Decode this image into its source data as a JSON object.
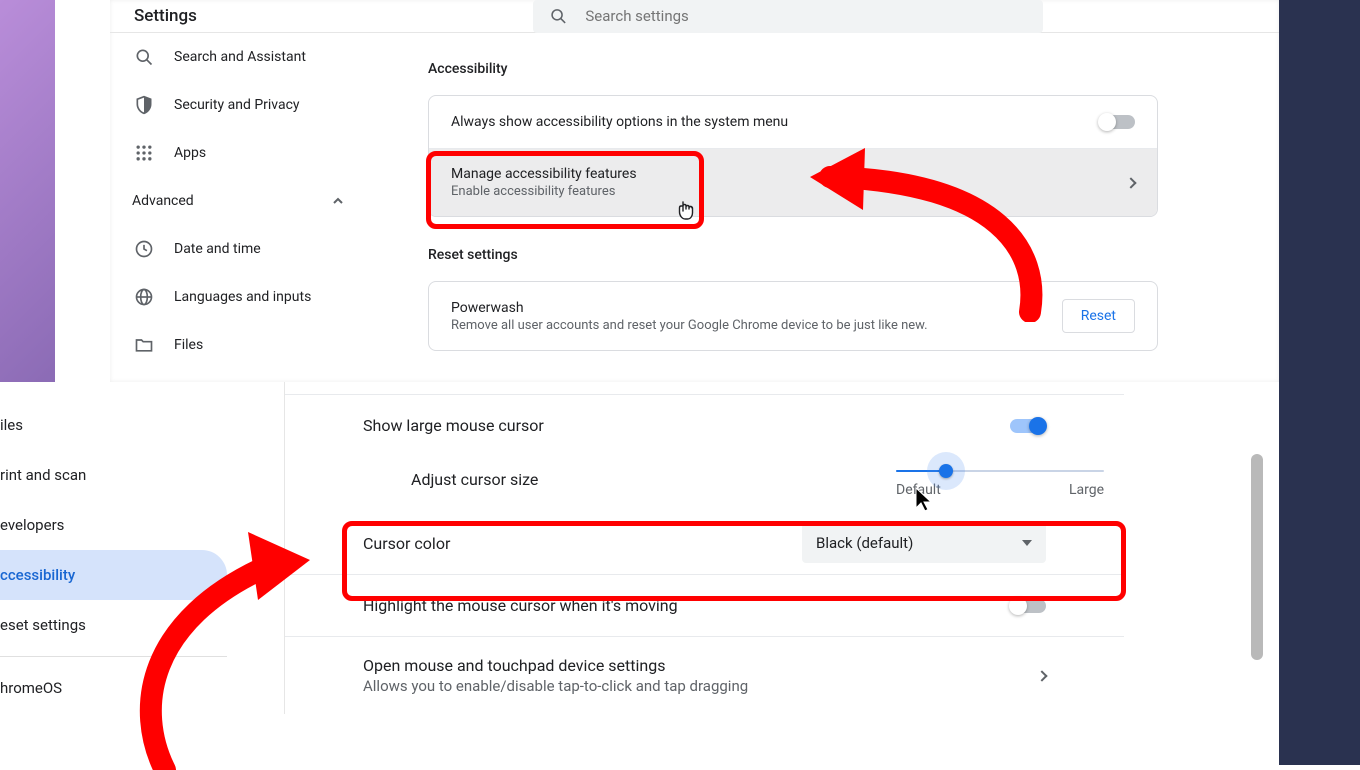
{
  "header": {
    "title": "Settings",
    "search_placeholder": "Search settings"
  },
  "sidebar_top": {
    "items": [
      {
        "label": "Search and Assistant"
      },
      {
        "label": "Security and Privacy"
      },
      {
        "label": "Apps"
      }
    ],
    "advanced_label": "Advanced",
    "adv_items": [
      {
        "label": "Date and time"
      },
      {
        "label": "Languages and inputs"
      },
      {
        "label": "Files"
      }
    ]
  },
  "accessibility": {
    "title": "Accessibility",
    "always_show": "Always show accessibility options in the system menu",
    "manage_title": "Manage accessibility features",
    "manage_sub": "Enable accessibility features"
  },
  "reset": {
    "title": "Reset settings",
    "pw_title": "Powerwash",
    "pw_sub": "Remove all user accounts and reset your Google Chrome device to be just like new.",
    "reset_btn": "Reset"
  },
  "sidebar_bot": {
    "items": [
      {
        "label": "iles"
      },
      {
        "label": "rint and scan"
      },
      {
        "label": "evelopers"
      },
      {
        "label": "ccessibility",
        "active": true
      },
      {
        "label": "eset settings"
      },
      {
        "label": "hromeOS"
      }
    ]
  },
  "mouse": {
    "show_large": "Show large mouse cursor",
    "adjust": "Adjust cursor size",
    "slider_min": "Default",
    "slider_max": "Large",
    "cursor_color_label": "Cursor color",
    "cursor_color_value": "Black (default)",
    "highlight": "Highlight the mouse cursor when it's moving",
    "open_title": "Open mouse and touchpad device settings",
    "open_sub": "Allows you to enable/disable tap-to-click and tap dragging"
  }
}
